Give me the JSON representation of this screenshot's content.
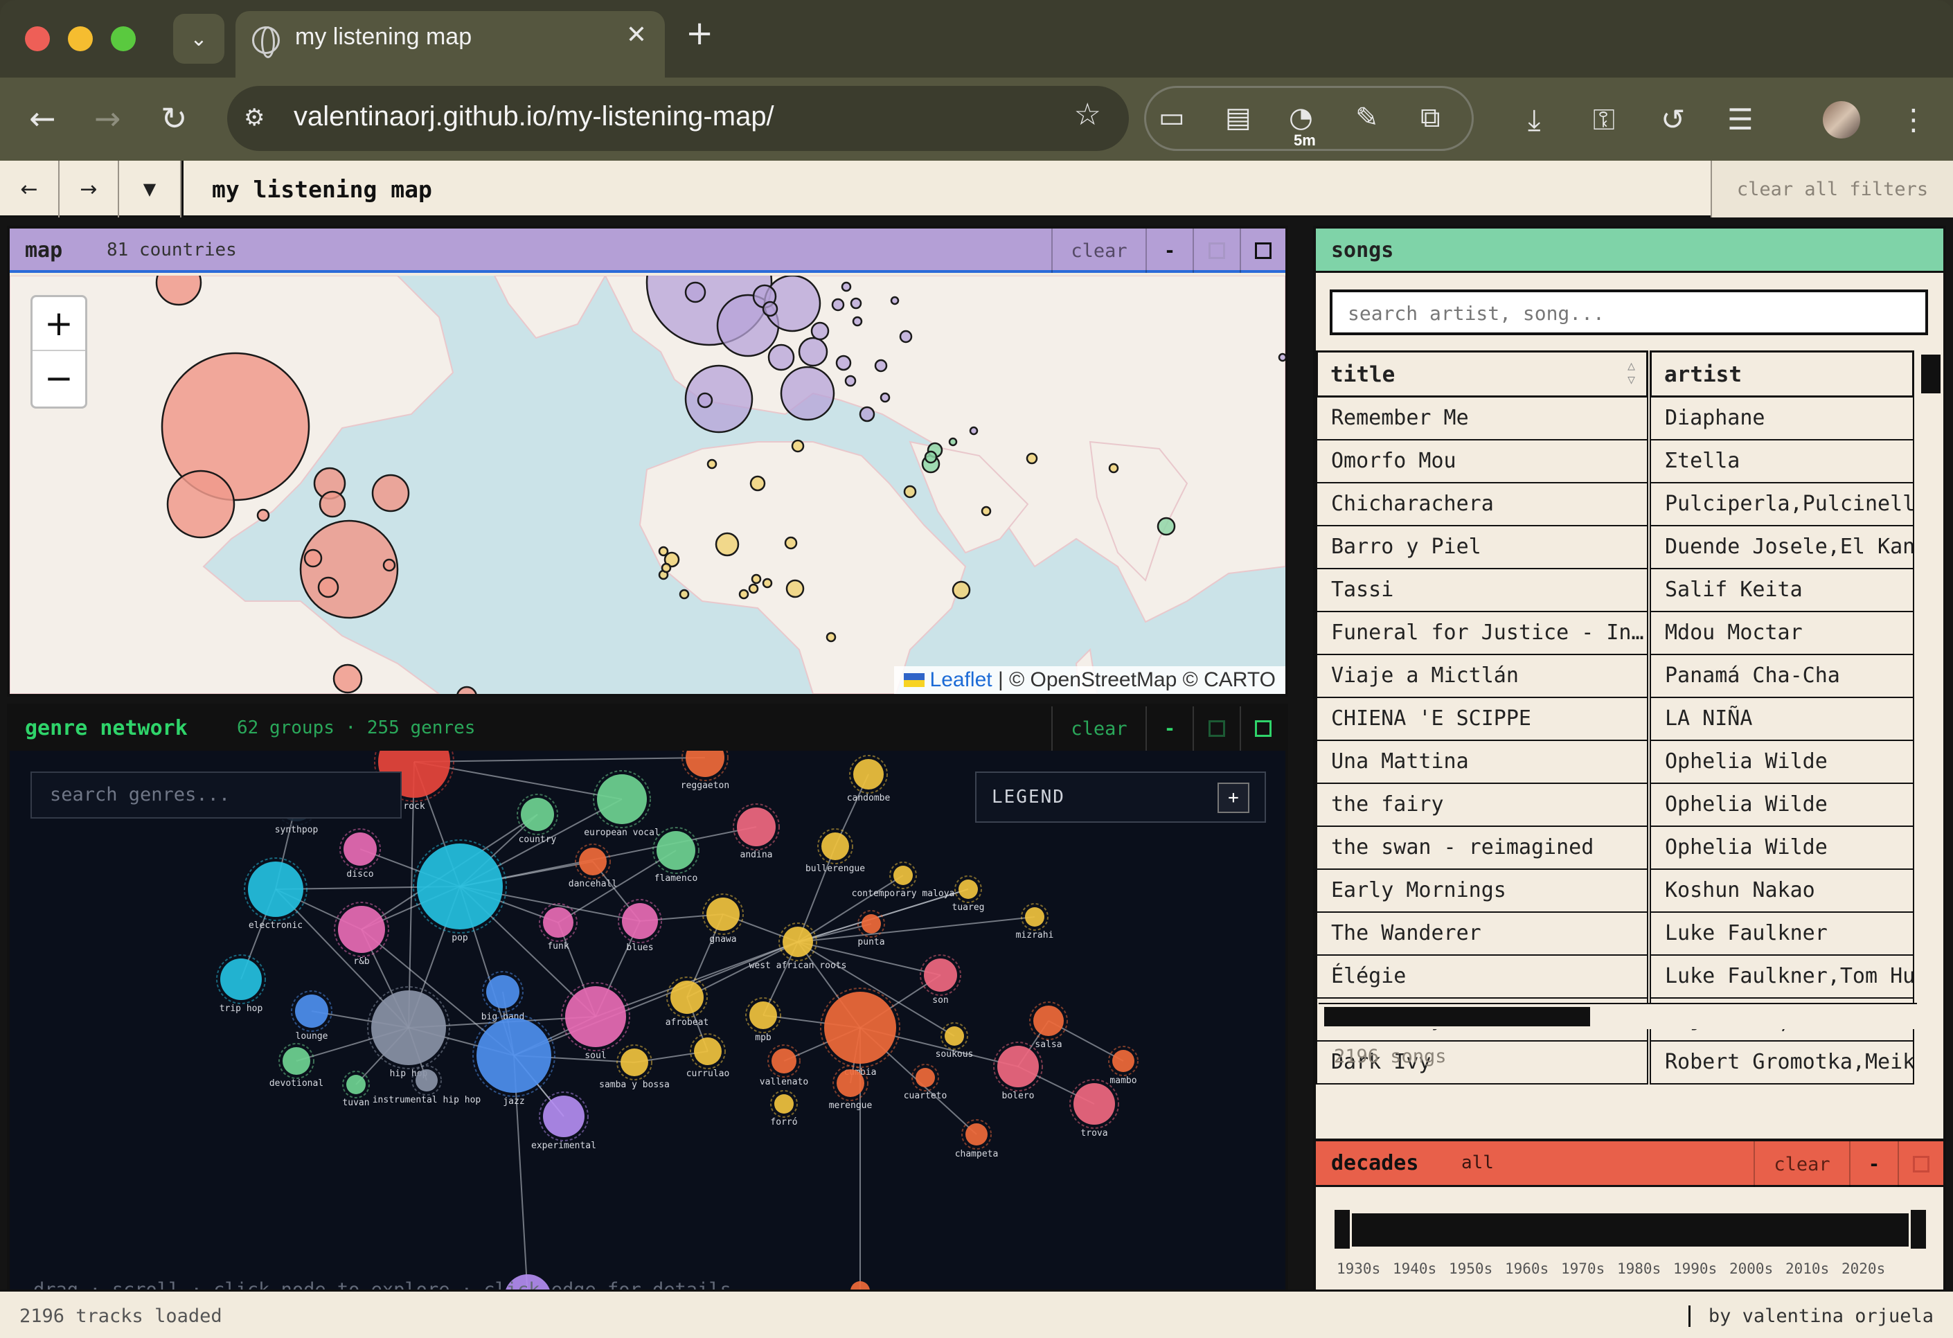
{
  "browser": {
    "tab_title": "my listening map",
    "url": "valentinaorj.github.io/my-listening-map/",
    "ext_badge": "5m"
  },
  "app": {
    "title": "my listening map",
    "clear_all": "clear all filters",
    "nav_back": "←",
    "nav_forward": "→",
    "nav_menu": "▼"
  },
  "map": {
    "title": "map",
    "subtitle": "81 countries",
    "clear": "clear",
    "minimize": "-",
    "zoom_in": "+",
    "zoom_out": "−",
    "attribution_leaflet": "Leaflet",
    "attribution_rest": " | © OpenStreetMap © CARTO",
    "accent_us": "#f09a8c",
    "accent_eu": "#b7a3d8",
    "accent_af": "#f0d37a",
    "accent_me": "#8fd6a7"
  },
  "genre": {
    "title": "genre network",
    "subtitle": "62 groups · 255 genres",
    "clear": "clear",
    "minimize": "-",
    "search_placeholder": "search genres...",
    "legend_label": "LEGEND",
    "legend_toggle": "+",
    "hint": "drag · scroll · click node to explore · click edge for details",
    "nodes": [
      {
        "label": "rock"
      },
      {
        "label": "synthpop"
      },
      {
        "label": "disco"
      },
      {
        "label": "country"
      },
      {
        "label": "european vocal"
      },
      {
        "label": "reggaeton"
      },
      {
        "label": "candombe"
      },
      {
        "label": "andina"
      },
      {
        "label": "flamenco"
      },
      {
        "label": "dancehall"
      },
      {
        "label": "bullerengue"
      },
      {
        "label": "contemporary maloya"
      },
      {
        "label": "tuareg"
      },
      {
        "label": "mizrahi"
      },
      {
        "label": "electronic"
      },
      {
        "label": "pop"
      },
      {
        "label": "r&b"
      },
      {
        "label": "funk"
      },
      {
        "label": "blues"
      },
      {
        "label": "gnawa"
      },
      {
        "label": "punta"
      },
      {
        "label": "west african roots"
      },
      {
        "label": "trip hop"
      },
      {
        "label": "lounge"
      },
      {
        "label": "big band"
      },
      {
        "label": "afrobeat"
      },
      {
        "label": "mpb"
      },
      {
        "label": "son"
      },
      {
        "label": "soul"
      },
      {
        "label": "salsa"
      },
      {
        "label": "cumbia"
      },
      {
        "label": "soukous"
      },
      {
        "label": "hip hop"
      },
      {
        "label": "devotional"
      },
      {
        "label": "tuvan"
      },
      {
        "label": "instrumental hip hop"
      },
      {
        "label": "jazz"
      },
      {
        "label": "samba y bossa"
      },
      {
        "label": "currulao"
      },
      {
        "label": "vallenato"
      },
      {
        "label": "merengue"
      },
      {
        "label": "cuarteto"
      },
      {
        "label": "bolero"
      },
      {
        "label": "mambo"
      },
      {
        "label": "trova"
      },
      {
        "label": "forró"
      },
      {
        "label": "experimental"
      },
      {
        "label": "champeta"
      }
    ]
  },
  "songs": {
    "title": "songs",
    "search_placeholder": "search artist, song...",
    "col_title": "title",
    "col_artist": "artist",
    "sort_icon": "sort-arrows-icon",
    "rows": [
      {
        "title": "Remember Me",
        "artist": "Diaphane"
      },
      {
        "title": "Omorfo Mou",
        "artist": "Σtella"
      },
      {
        "title": "Chicharachera",
        "artist": "Pulciperla,Pulcinella"
      },
      {
        "title": "Barro y Piel",
        "artist": "Duende Josele,El Kank"
      },
      {
        "title": "Tassi",
        "artist": "Salif Keita"
      },
      {
        "title": "Funeral for Justice - In…",
        "artist": "Mdou Moctar"
      },
      {
        "title": "Viaje a Mictlán",
        "artist": "Panamá Cha-Cha"
      },
      {
        "title": "CHIENA 'E SCIPPE",
        "artist": "LA NIÑA"
      },
      {
        "title": "Una Mattina",
        "artist": "Ophelia Wilde"
      },
      {
        "title": "the fairy",
        "artist": "Ophelia Wilde"
      },
      {
        "title": "the swan - reimagined",
        "artist": "Ophelia Wilde"
      },
      {
        "title": "Early Mornings",
        "artist": "Koshun Nakao"
      },
      {
        "title": "The Wanderer",
        "artist": "Luke Faulkner"
      },
      {
        "title": "Élégie",
        "artist": "Luke Faulkner,Tom Hue"
      },
      {
        "title": "Wednesday",
        "artist": "Aija Alsiņa"
      },
      {
        "title": "Dark Ivy",
        "artist": "Robert Gromotka,Meike"
      }
    ],
    "count": "2196 songs"
  },
  "decades": {
    "title": "decades",
    "subtitle": "all",
    "clear": "clear",
    "minimize": "-",
    "labels": [
      "1930s",
      "1940s",
      "1950s",
      "1960s",
      "1970s",
      "1980s",
      "1990s",
      "2000s",
      "2010s",
      "2020s"
    ]
  },
  "status": {
    "left": "2196 tracks loaded",
    "right": "by valentina orjuela"
  }
}
